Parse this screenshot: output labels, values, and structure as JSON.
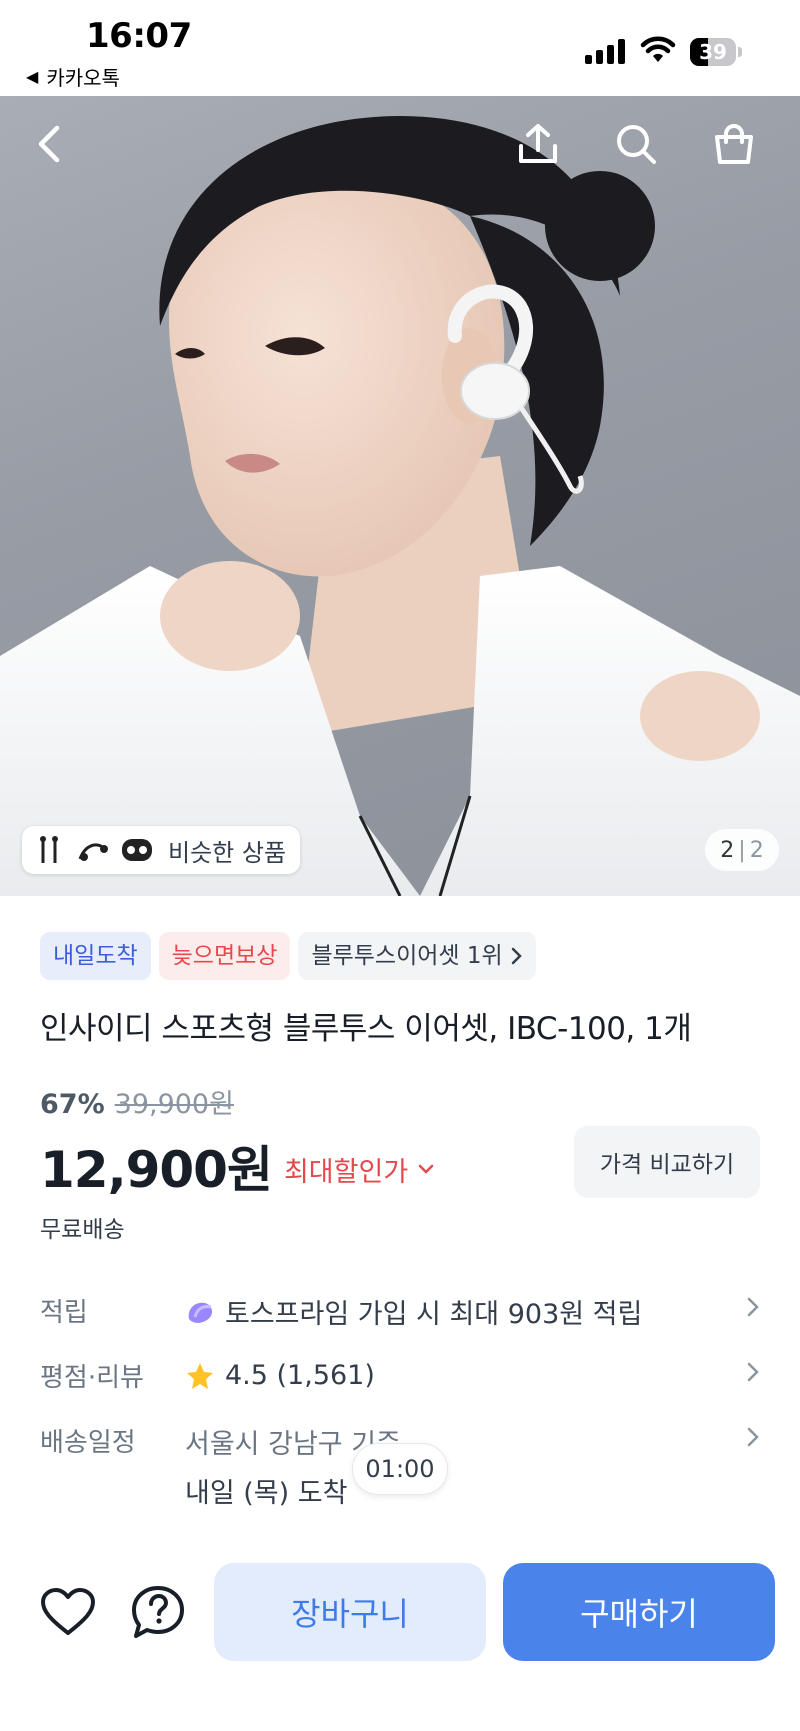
{
  "status_bar": {
    "time": "16:07",
    "back_app": "카카오톡",
    "battery": "39",
    "battery_level": 0.39
  },
  "hero": {
    "icons": [
      "back-arrow-icon",
      "share-icon",
      "search-icon",
      "shopping-bag-icon"
    ],
    "similar_label": "비슷한 상품",
    "similar_thumbs": [
      "wired-earphones-icon",
      "neckband-earphones-icon",
      "earbuds-case-icon"
    ],
    "page_current": "2",
    "page_sep": "|",
    "page_total": "2"
  },
  "badges": {
    "tomorrow": "내일도착",
    "late_comp": "늦으면보상",
    "rank": "블루투스이어셋 1위"
  },
  "product": {
    "title": "인사이디 스포츠형 블루투스 이어셋, IBC-100, 1개",
    "discount_pct": "67%",
    "original_price": "39,900원",
    "price": "12,900원",
    "max_discount": "최대할인가",
    "compare_button": "가격 비교하기",
    "shipping_note": "무료배송"
  },
  "info": {
    "points_key": "적립",
    "points_val": "토스프라임 가입 시 최대 903원 적립",
    "rating_key": "평점·리뷰",
    "rating_val": "4.5 (1,561)",
    "rating_value": 4.5,
    "delivery_key": "배송일정",
    "delivery_location": "서울시 강남구 기준",
    "delivery_date": "내일 (목) 도착",
    "countdown": "01:00"
  },
  "bottom": {
    "cart_label": "장바구니",
    "buy_label": "구매하기"
  },
  "colors": {
    "accent_blue": "#4a83ea",
    "cart_bg": "#e3ecfc",
    "sale_red": "#e5484d",
    "badge_blue": "#3b5fd8"
  }
}
